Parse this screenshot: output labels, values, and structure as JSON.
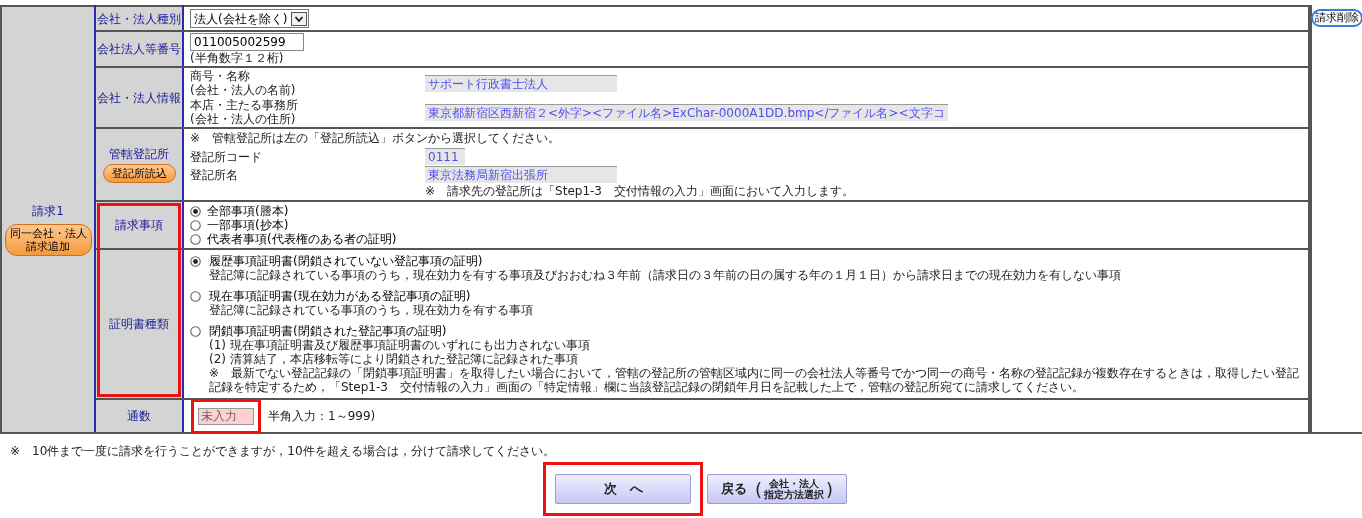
{
  "request_title": "請求1",
  "add_request_button": [
    "同一会社・法人",
    "請求追加"
  ],
  "delete_request_button": "請求削除",
  "corporate_type": {
    "label": "会社・法人種別",
    "value": "法人(会社を除く)"
  },
  "corporate_number": {
    "label": "会社法人等番号",
    "value": "011005002599",
    "hint": "(半角数字１２桁)"
  },
  "corporate_info": {
    "label": "会社・法人情報",
    "items": [
      {
        "label": "商号・名称",
        "sublabel": "(会社・法人の名前)",
        "value": "サポート行政書士法人"
      },
      {
        "label": "本店・主たる事務所",
        "sublabel": "(会社・法人の住所)",
        "value": "東京都新宿区西新宿２<外字><ファイル名>ExChar-0000A1DD.bmp</ファイル名><文字コ"
      }
    ]
  },
  "registry_office": {
    "label": "管轄登記所",
    "button": "登記所読込",
    "notice": "※　管轄登記所は左の「登記所読込」ボタンから選択してください。",
    "items": [
      {
        "label": "登記所コード",
        "value": "0111"
      },
      {
        "label": "登記所名",
        "value": "東京法務局新宿出張所"
      }
    ],
    "footnote": "※　請求先の登記所は「Step1-3　交付情報の入力」画面において入力します。"
  },
  "request_items": {
    "label": "請求事項",
    "options": [
      {
        "label": "全部事項(謄本)",
        "selected": true
      },
      {
        "label": "一部事項(抄本)",
        "selected": false
      },
      {
        "label": "代表者事項(代表権のある者の証明)",
        "selected": false
      }
    ]
  },
  "certificate_type": {
    "label": "証明書種類",
    "options": [
      {
        "label": "履歴事項証明書(閉鎖されていない登記事項の証明)",
        "selected": true,
        "notes": [
          "登記簿に記録されている事項のうち，現在効力を有する事項及びおおむね３年前（請求日の３年前の日の属する年の１月１日）から請求日までの現在効力を有しない事項"
        ]
      },
      {
        "label": "現在事項証明書(現在効力がある登記事項の証明)",
        "selected": false,
        "notes": [
          "登記簿に記録されている事項のうち，現在効力を有する事項"
        ]
      },
      {
        "label": "閉鎖事項証明書(閉鎖された登記事項の証明)",
        "selected": false,
        "notes": [
          "(1) 現在事項証明書及び履歴事項証明書のいずれにも出力されない事項",
          "(2) 清算結了，本店移転等により閉鎖された登記簿に記録された事項",
          "※　最新でない登記記録の「閉鎖事項証明書」を取得したい場合において，管轄の登記所の管轄区域内に同一の会社法人等番号でかつ同一の商号・名称の登記記録が複数存在するときは，取得したい登記記録を特定するため，「Step1-3　交付情報の入力」画面の「特定情報」欄に当該登記記録の閉鎖年月日を記載した上で，管轄の登記所宛てに請求してください。"
        ]
      }
    ]
  },
  "copies": {
    "label": "通数",
    "placeholder": "未入力",
    "hint": "半角入力：1～999)"
  },
  "notice": "※　10件まで一度に請求を行うことができますが，10件を超える場合は，分けて請求してください。",
  "next_button": "次　へ",
  "back_button": {
    "label": "戻る",
    "open": "(",
    "detail": [
      "会社・法人",
      "指定方法選択"
    ],
    "close": ")"
  }
}
